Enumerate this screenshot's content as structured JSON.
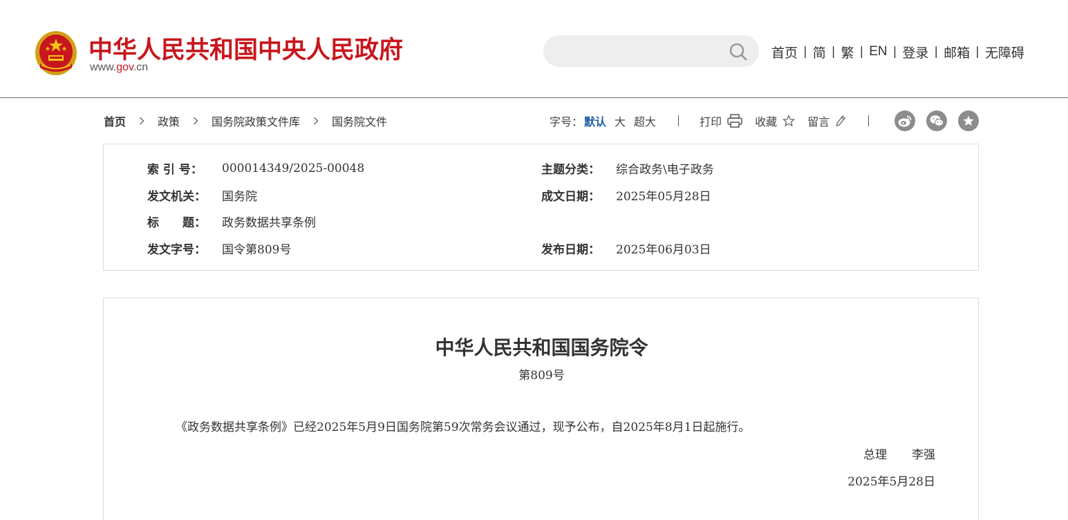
{
  "header": {
    "site_title": "中华人民共和国中央人民政府",
    "site_domain_prefix": "www.",
    "site_domain_gov": "gov",
    "site_domain_suffix": ".cn",
    "search": {
      "placeholder": "",
      "value": ""
    },
    "nav": [
      {
        "label": "首页"
      },
      {
        "label": "简"
      },
      {
        "label": "繁"
      },
      {
        "label": "EN"
      },
      {
        "label": "登录"
      },
      {
        "label": "邮箱"
      },
      {
        "label": "无障碍"
      }
    ],
    "brand_color": "#c8161d"
  },
  "breadcrumb": [
    "首页",
    "政策",
    "国务院政策文件库",
    "国务院文件"
  ],
  "tools": {
    "font_size_label": "字号：",
    "sizes": [
      {
        "label": "默认",
        "active": true
      },
      {
        "label": "大",
        "active": false
      },
      {
        "label": "超大",
        "active": false
      }
    ],
    "print_label": "打印",
    "favorite_label": "收藏",
    "message_label": "留言",
    "share_icons": [
      "weibo-icon",
      "wechat-icon",
      "favorite-star-icon"
    ],
    "active_color": "#1f5fa6"
  },
  "info": {
    "index_no": {
      "label": "索 引 号：",
      "value": "000014349/2025-00048"
    },
    "category": {
      "label": "主题分类：",
      "value": "综合政务\\电子政务"
    },
    "issuer": {
      "label": "发文机关：",
      "value": "国务院"
    },
    "written_date": {
      "label": "成文日期：",
      "value": "2025年05月28日"
    },
    "title": {
      "label": "标　　题：",
      "value": "政务数据共享条例"
    },
    "doc_no": {
      "label": "发文字号：",
      "value": "国令第809号"
    },
    "publish_date": {
      "label": "发布日期：",
      "value": "2025年06月03日"
    }
  },
  "document": {
    "title": "中华人民共和国国务院令",
    "number": "第809号",
    "body": "《政务数据共享条例》已经2025年5月9日国务院第59次常务会议通过，现予公布，自2025年8月1日起施行。",
    "signer_title": "总理",
    "signer_name": "李强",
    "date": "2025年5月28日"
  }
}
